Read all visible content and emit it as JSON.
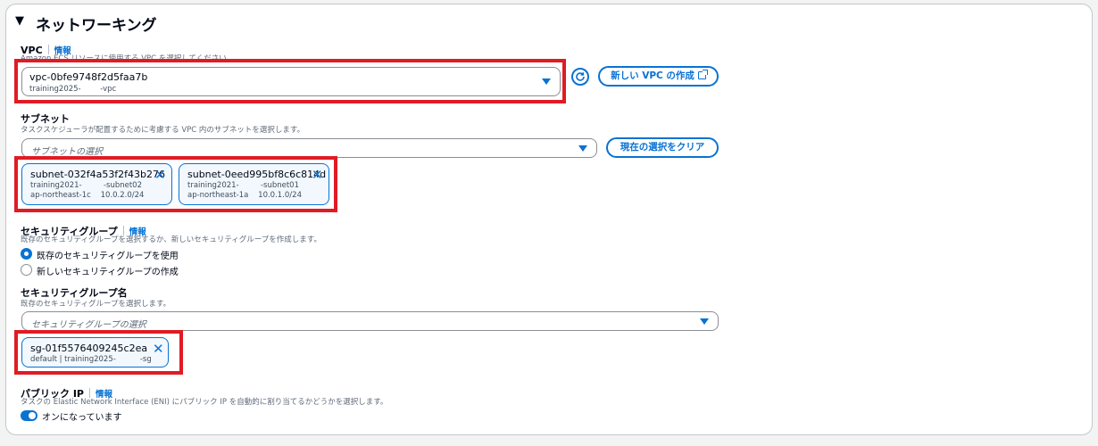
{
  "section": {
    "caret": "▼",
    "title": "ネットワーキング"
  },
  "vpc": {
    "label": "VPC",
    "info": "情報",
    "description": "Amazon ECS リソースに使用する VPC を選択してください",
    "selected_id": "vpc-0bfe9748f2d5faa7b",
    "selected_name": "training2025-        -vpc",
    "create_button": "新しい VPC の作成"
  },
  "subnet": {
    "label": "サブネット",
    "description": "タスクスケジューラが配置するために考慮する VPC 内のサブネットを選択します。",
    "placeholder": "サブネットの選択",
    "clear_button": "現在の選択をクリア",
    "tokens": [
      {
        "id": "subnet-032f4a53f2f43b276",
        "name": "training2021-         -subnet02",
        "detail": "ap-northeast-1c    10.0.2.0/24"
      },
      {
        "id": "subnet-0eed995bf8c6c814d",
        "name": "training2021-         -subnet01",
        "detail": "ap-northeast-1a    10.0.1.0/24"
      }
    ]
  },
  "security_group": {
    "label": "セキュリティグループ",
    "info": "情報",
    "description": "既存のセキュリティグループを選択するか、新しいセキュリティグループを作成します。",
    "options": [
      {
        "label": "既存のセキュリティグループを使用",
        "selected": true
      },
      {
        "label": "新しいセキュリティグループの作成",
        "selected": false
      }
    ]
  },
  "security_group_name": {
    "label": "セキュリティグループ名",
    "description": "既存のセキュリティグループを選択します。",
    "placeholder": "セキュリティグループの選択",
    "token": {
      "id": "sg-01f5576409245c2ea",
      "detail": "default | training2025-          -sg"
    }
  },
  "public_ip": {
    "label": "パブリック IP",
    "info": "情報",
    "description": "タスクの Elastic Network Interface (ENI) にパブリック IP を自動的に割り当てるかどうかを選択します。",
    "toggle_label": "オンになっています",
    "enabled": true
  },
  "colors": {
    "accent": "#0972d3",
    "highlight": "#e01b24",
    "text": "#000716",
    "muted": "#5f6b7a"
  }
}
